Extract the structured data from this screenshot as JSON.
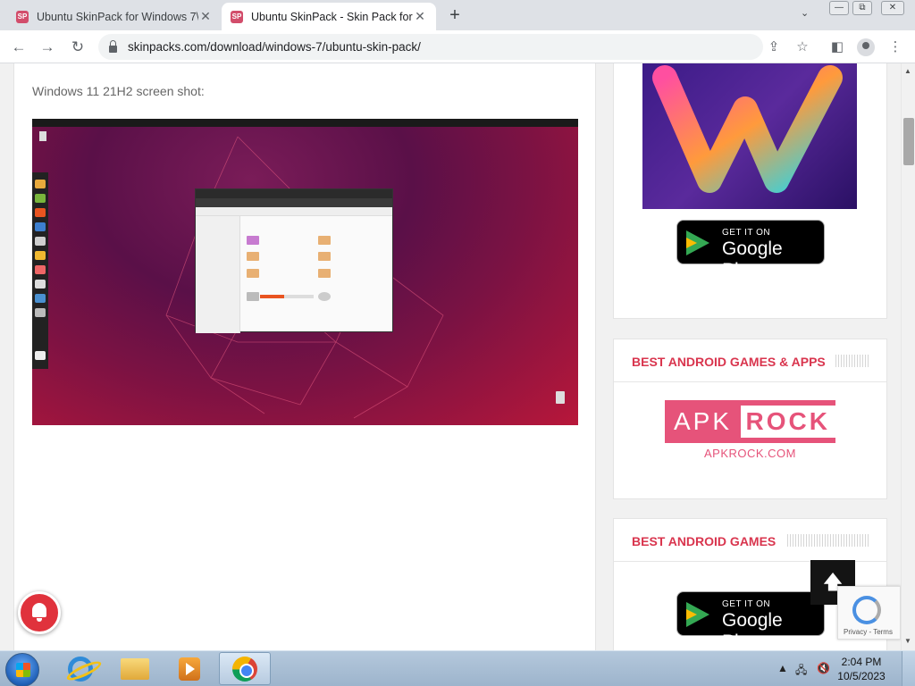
{
  "browser": {
    "tabs": [
      {
        "title": "Ubuntu SkinPack for Windows 7\\",
        "favicon": "SP",
        "active": false
      },
      {
        "title": "Ubuntu SkinPack - Skin Pack for",
        "favicon": "SP",
        "active": true
      }
    ],
    "new_tab": "+",
    "url": "skinpacks.com/download/windows-7/ubuntu-skin-pack/",
    "window_controls": {
      "minimize": "—",
      "maximize": "⧉",
      "close": "✕"
    }
  },
  "content": {
    "caption": "Windows 11 21H2 screen shot:"
  },
  "sidebar": {
    "play_badge_small": "GET IT ON",
    "play_badge_big": "Google Play",
    "section1_title": "BEST ANDROID GAMES & APPS",
    "apk_logo_left": "APK",
    "apk_logo_right": "ROCK",
    "apk_link": "APKROCK.COM",
    "section2_title": "BEST ANDROID GAMES"
  },
  "recaptcha": {
    "terms": "Privacy - Terms"
  },
  "taskbar": {
    "time": "2:04 PM",
    "date": "10/5/2023"
  },
  "colors": {
    "accent": "#d9354e",
    "apk_pink": "#e6537a",
    "ubuntu_orange": "#e95420"
  }
}
